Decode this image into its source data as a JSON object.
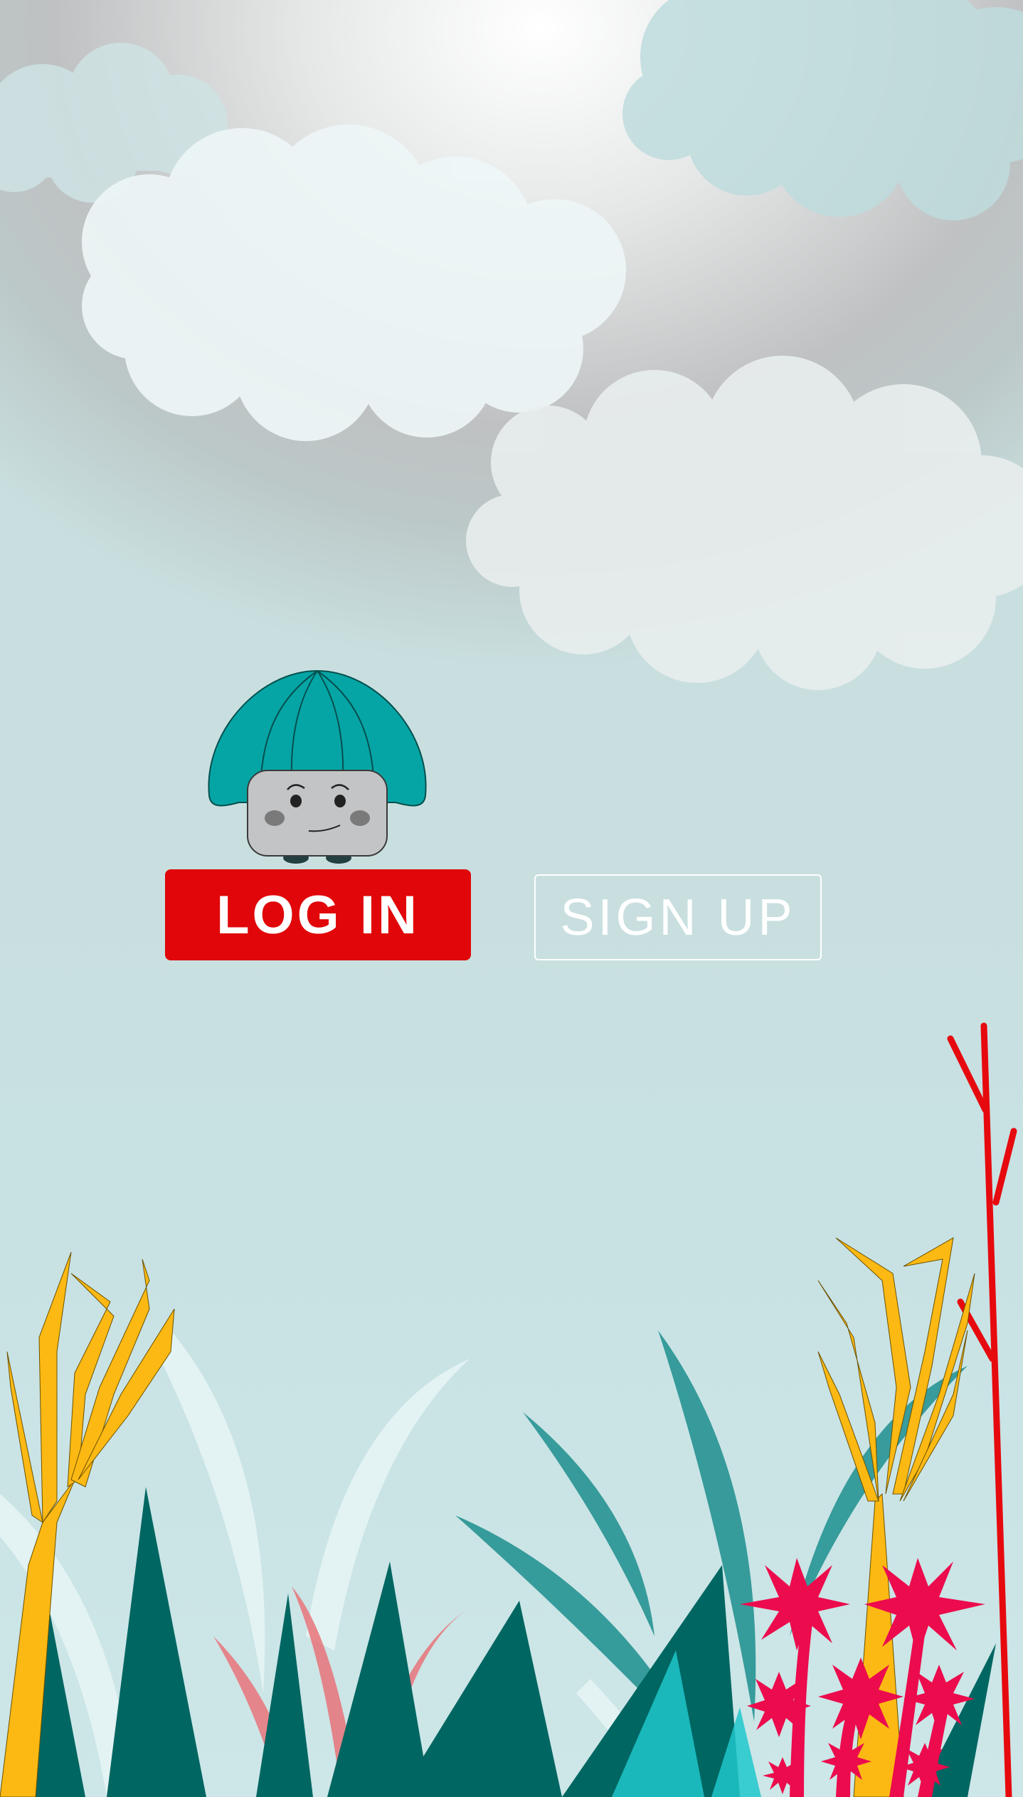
{
  "screen": {
    "login_label": "LOG IN",
    "signup_label": "SIGN UP"
  },
  "colors": {
    "login_button": "#e00609",
    "signup_border": "#ffffff",
    "mascot_cap": "#06a5a5",
    "mascot_face": "#c2c4c6",
    "cloud": "#eef6f7",
    "plant_dark": "#006662",
    "plant_yellow": "#fdb913",
    "plant_red": "#ea1c24",
    "flower_pink": "#ec0b4d"
  },
  "icons": {
    "mascot": "mushroom-mascot-icon",
    "clouds": "cloud-icon",
    "plants": "plant-icon"
  }
}
